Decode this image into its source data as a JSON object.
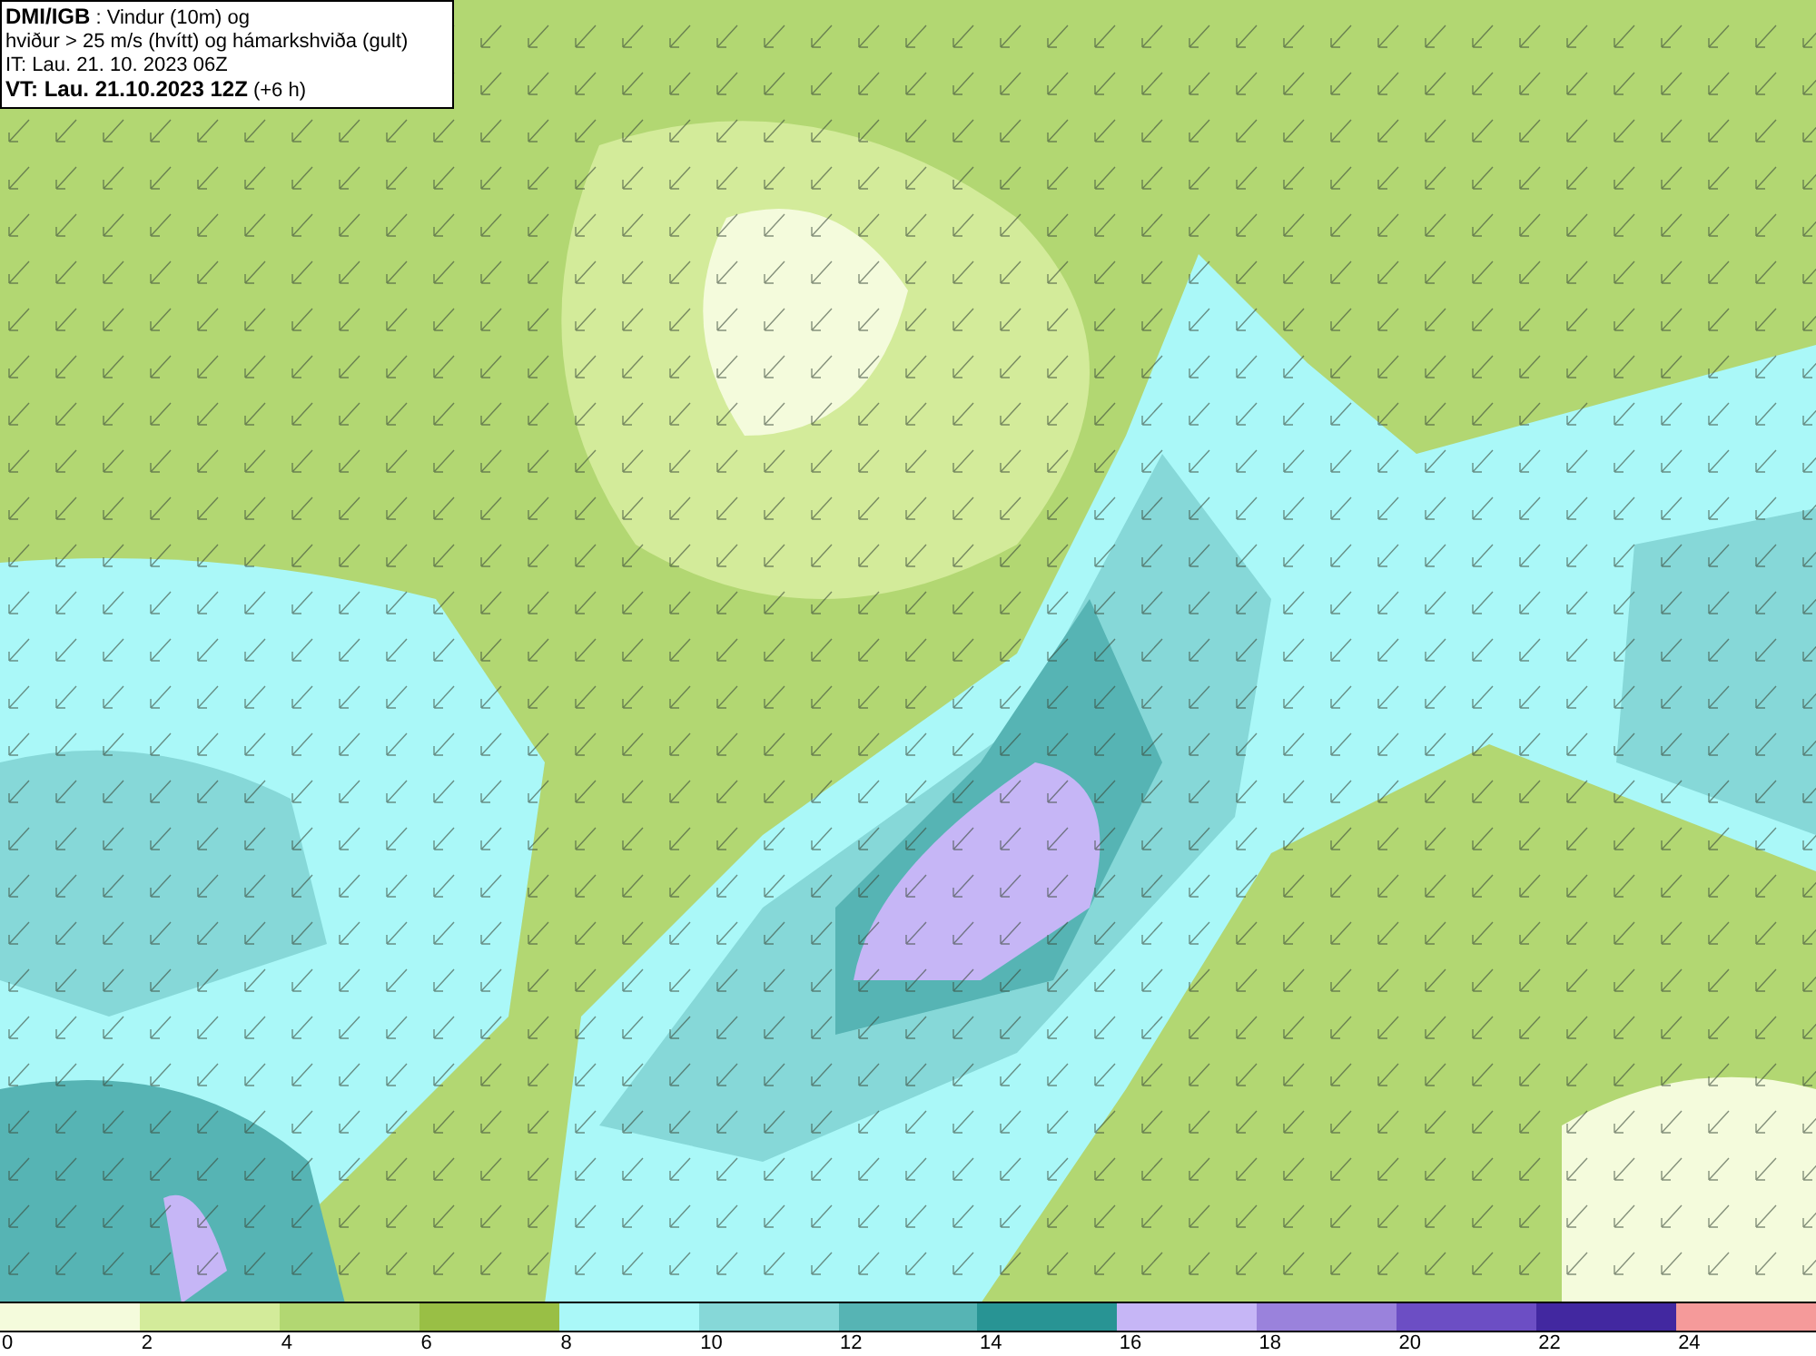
{
  "title_box": {
    "lines": [
      "**DMI/IGB** : Vindur (10m) og",
      "hviður > 25 m/s (hvítt) og hámarkshviða (gult)",
      "IT: Lau. 21. 10. 2023 06Z",
      "**VT: Lau. 21.10.2023 12Z** (+6 h)"
    ]
  },
  "legend": {
    "bins": [
      {
        "color": "#f4fbdc"
      },
      {
        "color": "#d3eb9a"
      },
      {
        "color": "#b2d772"
      },
      {
        "color": "#99bf45"
      },
      {
        "color": "#aaf8f8"
      },
      {
        "color": "#86d8d8"
      },
      {
        "color": "#56b4b4"
      },
      {
        "color": "#289494"
      },
      {
        "color": "#c6b6f6"
      },
      {
        "color": "#9a82dc"
      },
      {
        "color": "#6c4ec4"
      },
      {
        "color": "#4228a0"
      },
      {
        "color": "#f59a9a"
      }
    ],
    "ticks": [
      "0",
      "2",
      "4",
      "6",
      "8",
      "10",
      "12",
      "14",
      "16",
      "18",
      "20",
      "22",
      "24"
    ]
  }
}
